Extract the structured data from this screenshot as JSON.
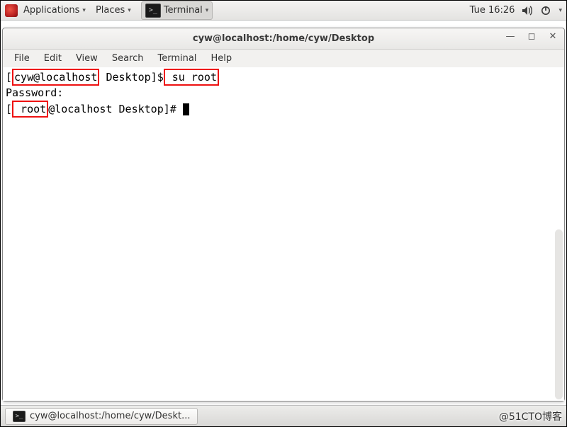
{
  "topbar": {
    "applications": "Applications",
    "places": "Places",
    "terminal": "Terminal",
    "clock": "Tue 16:26"
  },
  "window": {
    "title": "cyw@localhost:/home/cyw/Desktop",
    "menus": [
      "File",
      "Edit",
      "View",
      "Search",
      "Terminal",
      "Help"
    ]
  },
  "terminal": {
    "line1_user": "cyw@localhost",
    "line1_rest": " Desktop]$",
    "line1_cmd": " su root",
    "line2": "Password:",
    "line3_user": " root",
    "line3_rest": "@localhost Desktop]# "
  },
  "taskbar": {
    "label": "cyw@localhost:/home/cyw/Deskt..."
  },
  "watermark": "@51CTO博客"
}
